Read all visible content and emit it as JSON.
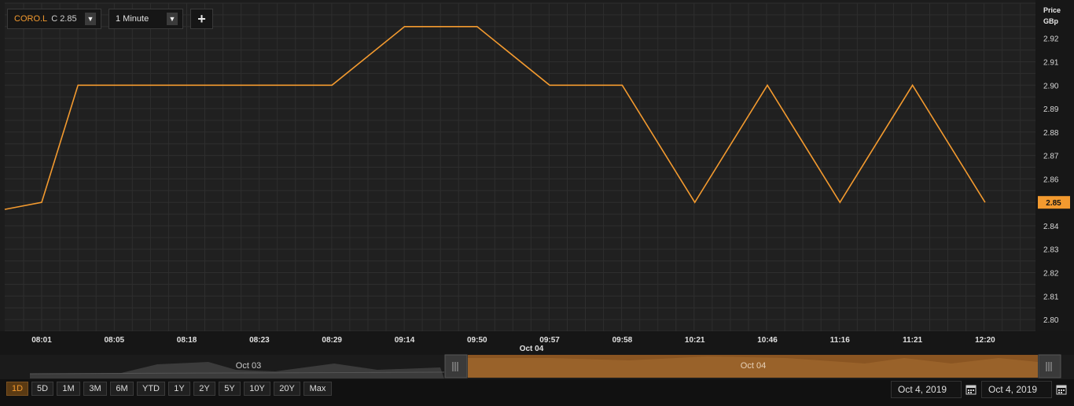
{
  "toolbar": {
    "symbol": "CORO.L",
    "close_label": "C 2.85",
    "interval": "1 Minute",
    "dropdown_glyph": "▼",
    "add_glyph": "+"
  },
  "axis": {
    "price_label": "Price",
    "unit_label": "GBp",
    "current_price_label": "2.85"
  },
  "chart_data": {
    "type": "line",
    "x": [
      "08:01",
      "08:05",
      "08:18",
      "08:23",
      "08:29",
      "09:14",
      "09:50",
      "09:57",
      "09:58",
      "10:21",
      "10:46",
      "11:16",
      "11:21",
      "12:20"
    ],
    "date_label": "Oct 04",
    "series": [
      {
        "points": [
          {
            "t": 0,
            "v": 2.85
          },
          {
            "t": 0.5,
            "v": 2.9
          },
          {
            "t": 4.0,
            "v": 2.9
          },
          {
            "t": 5.0,
            "v": 2.925
          },
          {
            "t": 6.0,
            "v": 2.925
          },
          {
            "t": 7.0,
            "v": 2.9
          },
          {
            "t": 8.0,
            "v": 2.9
          },
          {
            "t": 9.0,
            "v": 2.85
          },
          {
            "t": 10.0,
            "v": 2.9
          },
          {
            "t": 11.0,
            "v": 2.85
          },
          {
            "t": 12.0,
            "v": 2.9
          },
          {
            "t": 13.0,
            "v": 2.85
          }
        ],
        "color": "#f39a2f"
      }
    ],
    "yticks": [
      2.8,
      2.81,
      2.82,
      2.83,
      2.84,
      2.85,
      2.86,
      2.87,
      2.88,
      2.89,
      2.9,
      2.91,
      2.92
    ],
    "ylim": [
      2.795,
      2.935
    ],
    "current_value": 2.85,
    "grid": true
  },
  "navigator": {
    "left_label": "Oct 03",
    "right_label": "Oct 04"
  },
  "ranges": [
    "1D",
    "5D",
    "1M",
    "3M",
    "6M",
    "YTD",
    "1Y",
    "2Y",
    "5Y",
    "10Y",
    "20Y",
    "Max"
  ],
  "active_range": "1D",
  "dates": {
    "start": "Oct 4, 2019",
    "end": "Oct 4, 2019"
  },
  "colors": {
    "accent": "#f39a2f",
    "background": "#1c1c1c",
    "grid": "#2e2e2e"
  }
}
